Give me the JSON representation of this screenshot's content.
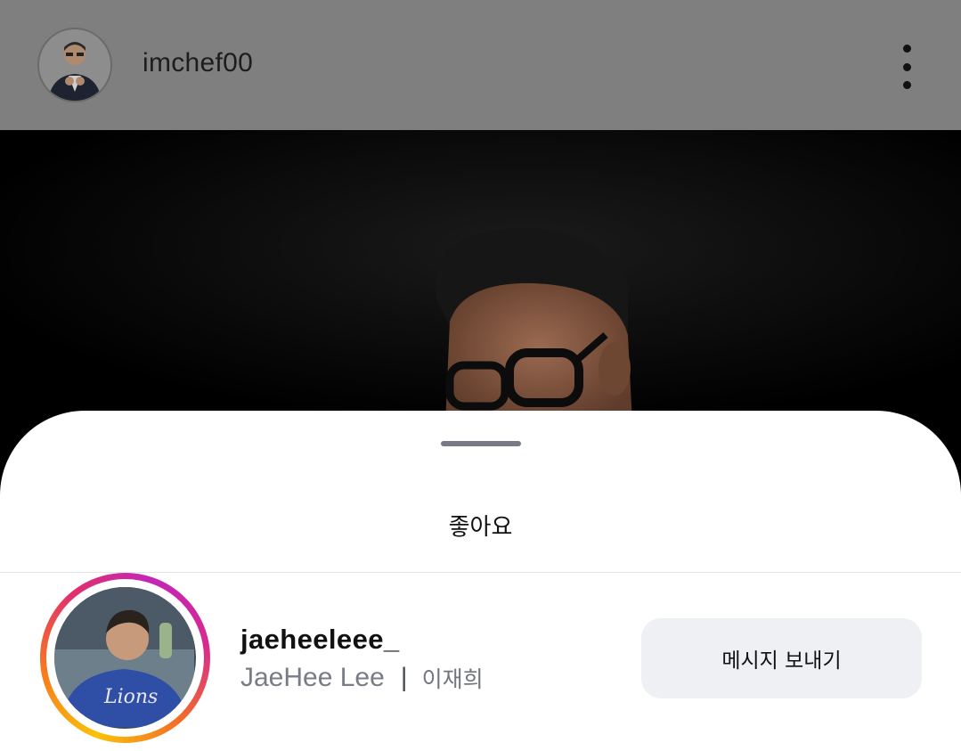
{
  "header": {
    "username": "imchef00",
    "avatar_icon": "profile-photo",
    "more_icon": "more-vertical-icon"
  },
  "post": {
    "image": "post-photo"
  },
  "likes_sheet": {
    "title": "좋아요",
    "users": [
      {
        "username": "jaeheeleee_",
        "full_name": "JaeHee Lee",
        "separator": "|",
        "korean_name": "이재희",
        "button_label": "메시지 보내기",
        "has_story_ring": true
      }
    ]
  },
  "colors": {
    "header_dim": "#7f7f7f",
    "sheet_bg": "#ffffff",
    "button_bg": "#eff0f4",
    "handle": "#767b85",
    "secondary_text": "#777c85"
  }
}
